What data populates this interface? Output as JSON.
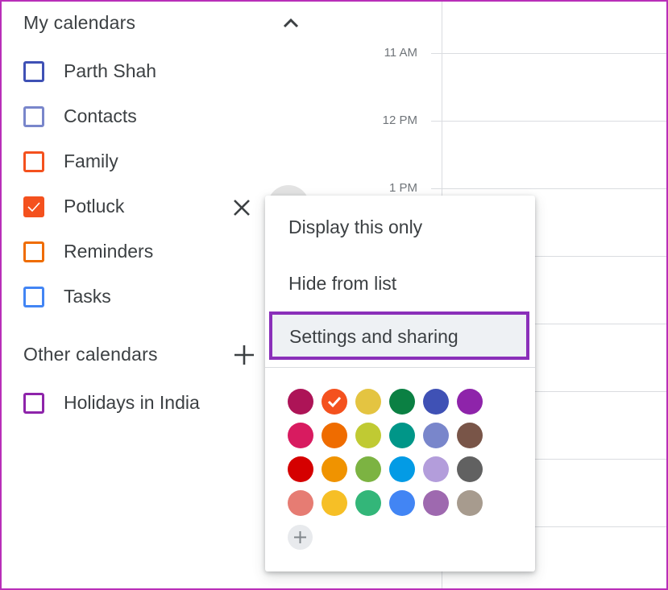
{
  "my_calendars": {
    "title": "My calendars",
    "collapse_icon": "chevron-up-icon",
    "items": [
      {
        "label": "Parth Shah",
        "color": "#3f51b5",
        "checked": false
      },
      {
        "label": "Contacts",
        "color": "#7986cb",
        "checked": false
      },
      {
        "label": "Family",
        "color": "#f4511e",
        "checked": false
      },
      {
        "label": "Potluck",
        "color": "#f4511e",
        "checked": true
      },
      {
        "label": "Reminders",
        "color": "#ef6c00",
        "checked": false
      },
      {
        "label": "Tasks",
        "color": "#4285f4",
        "checked": false
      }
    ],
    "remove_icon": "close-icon"
  },
  "other_calendars": {
    "title": "Other calendars",
    "add_icon": "plus-icon",
    "items": [
      {
        "label": "Holidays in India",
        "color": "#8e24aa",
        "checked": false
      }
    ]
  },
  "time_grid": {
    "labels": [
      "11 AM",
      "12 PM",
      "1 PM"
    ]
  },
  "menu": {
    "items": [
      "Display this only",
      "Hide from list",
      "Settings and sharing"
    ],
    "highlighted": "Settings and sharing",
    "selected_color": "#f4511e",
    "colors": [
      [
        "#ad1457",
        "#f4511e",
        "#e4c441",
        "#0b8043",
        "#3f51b5",
        "#8e24aa"
      ],
      [
        "#d81b60",
        "#ef6c00",
        "#c0ca33",
        "#009688",
        "#7986cb",
        "#795548"
      ],
      [
        "#d50000",
        "#f09300",
        "#7cb342",
        "#039be5",
        "#b39ddb",
        "#616161"
      ],
      [
        "#e67c73",
        "#f6bf26",
        "#33b679",
        "#4285f4",
        "#9e69af",
        "#a79b8e"
      ]
    ],
    "add_color_icon": "plus-icon"
  },
  "accent": "#b92fb9"
}
